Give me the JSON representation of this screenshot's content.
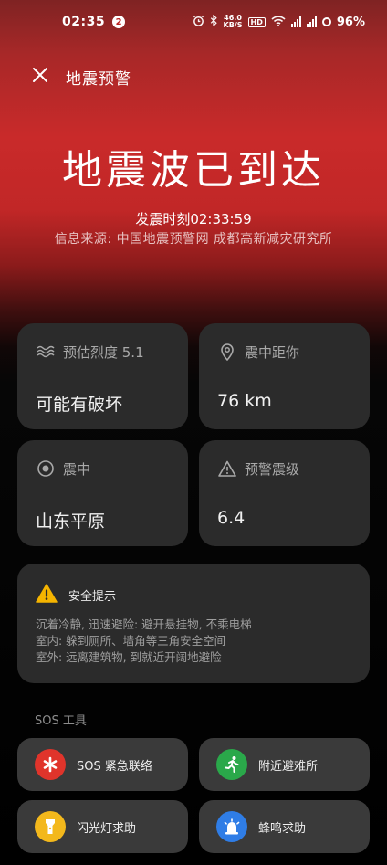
{
  "status": {
    "time": "02:35",
    "notification_count": "2",
    "net_speed_top": "46.0",
    "net_speed_bottom": "KB/S",
    "hd_label": "HD",
    "battery": "96%"
  },
  "header": {
    "title": "地震预警"
  },
  "alert": {
    "headline": "地震波已到达",
    "quake_time": "发震时刻02:33:59",
    "source": "信息来源: 中国地震预警网 成都高新减灾研究所"
  },
  "cards": {
    "intensity": {
      "label": "预估烈度 5.1",
      "value": "可能有破坏"
    },
    "distance": {
      "label": "震中距你",
      "value": "76 km"
    },
    "epicenter": {
      "label": "震中",
      "value": "山东平原"
    },
    "magnitude": {
      "label": "预警震级",
      "value": "6.4"
    }
  },
  "safety": {
    "title": "安全提示",
    "lines": [
      "沉着冷静, 迅速避险: 避开悬挂物, 不乘电梯",
      "室内: 躲到厕所、墙角等三角安全空间",
      "室外: 远离建筑物, 到就近开阔地避险"
    ]
  },
  "sos": {
    "section_title": "SOS 工具",
    "tools": [
      {
        "label": "SOS 紧急联络",
        "icon": "asterisk-icon",
        "color": "#e0342b"
      },
      {
        "label": "附近避难所",
        "icon": "running-person-icon",
        "color": "#2aa84a"
      },
      {
        "label": "闪光灯求助",
        "icon": "flashlight-icon",
        "color": "#f3b81c"
      },
      {
        "label": "蜂鸣求助",
        "icon": "siren-icon",
        "color": "#2f7de6"
      }
    ]
  },
  "colors": {
    "gradient_top": "#c92a2a",
    "card_bg": "#2b2b2b",
    "warning_yellow": "#f5b400"
  }
}
